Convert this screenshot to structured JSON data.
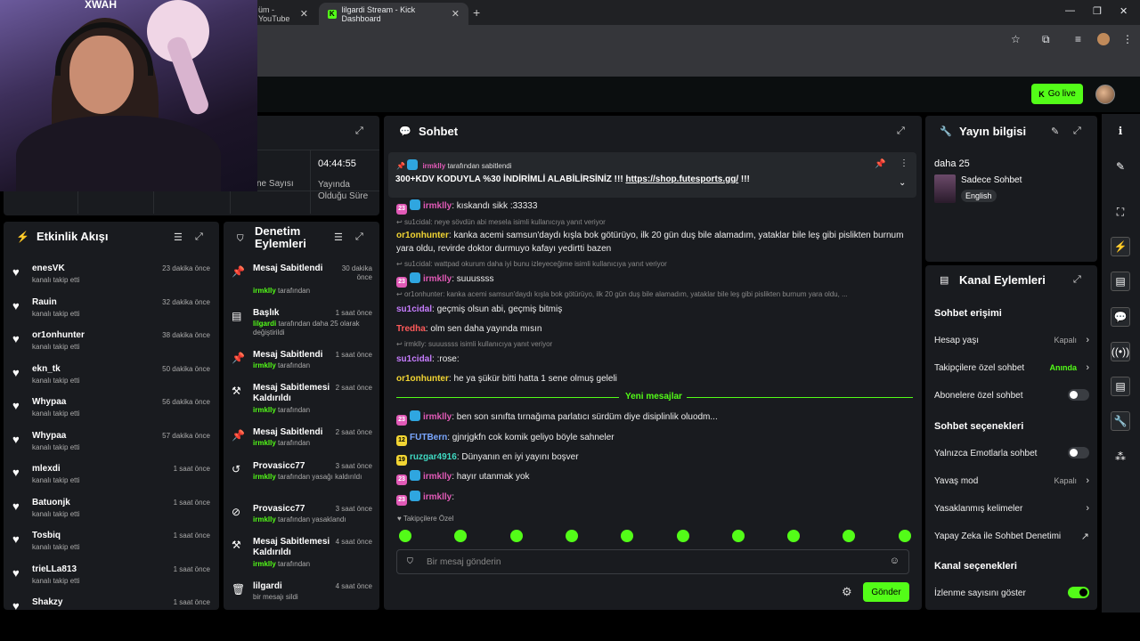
{
  "browser": {
    "tabs": [
      {
        "title": "üm - YouTube"
      },
      {
        "title": "lilgardi Stream - Kick Dashboard"
      }
    ],
    "new_tab": "+"
  },
  "topbar": {
    "go_live": "Go live"
  },
  "stats": {
    "uptime": "04:44:55",
    "uptime_label": "Yayında Olduğu Süre",
    "viewers_label": "ne Sayısı"
  },
  "activity": {
    "title": "Etkinlik Akışı",
    "items": [
      {
        "name": "enesVK",
        "action": "kanalı takip etti",
        "time": "23 dakika önce"
      },
      {
        "name": "Rauin",
        "action": "kanalı takip etti",
        "time": "32 dakika önce"
      },
      {
        "name": "or1onhunter",
        "action": "kanalı takip etti",
        "time": "38 dakika önce"
      },
      {
        "name": "ekn_tk",
        "action": "kanalı takip etti",
        "time": "50 dakika önce"
      },
      {
        "name": "Whypaa",
        "action": "kanalı takip etti",
        "time": "56 dakika önce"
      },
      {
        "name": "Whypaa",
        "action": "kanalı takip etti",
        "time": "57 dakika önce"
      },
      {
        "name": "mlexdi",
        "action": "kanalı takip etti",
        "time": "1 saat önce"
      },
      {
        "name": "Batuonjk",
        "action": "kanalı takip etti",
        "time": "1 saat önce"
      },
      {
        "name": "Tosbiq",
        "action": "kanalı takip etti",
        "time": "1 saat önce"
      },
      {
        "name": "trieLLa813",
        "action": "kanalı takip etti",
        "time": "1 saat önce"
      },
      {
        "name": "Shakzy",
        "action": "",
        "time": "1 saat önce"
      }
    ]
  },
  "moderation": {
    "title": "Denetim Eylemleri",
    "items": [
      {
        "title": "Mesaj Sabitlendi",
        "actor": "irmklly",
        "suffix": "tarafından",
        "time": "30 dakika önce",
        "icon": "pin-icon"
      },
      {
        "title": "Başlık",
        "actor": "lilgardi",
        "suffix": "tarafından daha 25 olarak değiştirildi",
        "time": "1 saat önce",
        "icon": "title-icon"
      },
      {
        "title": "Mesaj Sabitlendi",
        "actor": "irmklly",
        "suffix": "tarafından",
        "time": "1 saat önce",
        "icon": "pin-icon"
      },
      {
        "title": "Mesaj Sabitlemesi Kaldırıldı",
        "actor": "irmklly",
        "suffix": "tarafından",
        "time": "2 saat önce",
        "icon": "unpin-icon"
      },
      {
        "title": "Mesaj Sabitlendi",
        "actor": "irmklly",
        "suffix": "tarafından",
        "time": "2 saat önce",
        "icon": "pin-icon"
      },
      {
        "title": "Provasicc77",
        "actor": "irmklly",
        "suffix": "tarafından yasağı kaldırıldı",
        "time": "3 saat önce",
        "icon": "undo-icon"
      },
      {
        "title": "Provasicc77",
        "actor": "irmklly",
        "suffix": "tarafından yasaklandı",
        "time": "3 saat önce",
        "icon": "ban-icon"
      },
      {
        "title": "Mesaj Sabitlemesi Kaldırıldı",
        "actor": "irmklly",
        "suffix": "tarafından",
        "time": "4 saat önce",
        "icon": "unpin-icon"
      },
      {
        "title": "lilgardi",
        "actor": "",
        "suffix": "bir mesajı sildi",
        "time": "4 saat önce",
        "icon": "trash-icon"
      }
    ]
  },
  "chat": {
    "title": "Sohbet",
    "pinned": {
      "by_user": "irmklly",
      "by_text": "tarafından sabitlendi",
      "message": "300+KDV KODUYLA %30 İNDİRİMLİ ALABİLİRSİNİZ !!!",
      "link": "https://shop.futesports.gg/",
      "suffix": "!!!"
    },
    "messages": [
      {
        "type": "msg",
        "user": "irmklly",
        "color": "#e15ab7",
        "text": ": kıskandı sikk :33333",
        "badges": [
          "b-pink",
          "b-blue"
        ]
      },
      {
        "type": "reply",
        "text": "su1cidal: neye sövdün abi mesela isimli kullanıcıya yanıt veriyor"
      },
      {
        "type": "msg",
        "user": "or1onhunter",
        "color": "#f2d533",
        "text": ": kanka acemi samsun'daydı kışla bok götürüyo, ilk 20 gün duş bile alamadım, yataklar bile leş gibi pislikten burnum yara oldu, revirde doktor durmuyo kafayı yedirtti bazen",
        "badges": []
      },
      {
        "type": "reply",
        "text": "su1cidal: wattpad okurum daha iyi bunu izleyeceğime isimli kullanıcıya yanıt veriyor"
      },
      {
        "type": "msg",
        "user": "irmklly",
        "color": "#e15ab7",
        "text": ": suuussss",
        "badges": [
          "b-pink",
          "b-blue"
        ]
      },
      {
        "type": "reply",
        "text": "or1onhunter: kanka acemi samsun'daydı kışla bok götürüyo, ilk 20 gün duş bile alamadım, yataklar bile leş gibi pislikten burnum yara oldu, ..."
      },
      {
        "type": "msg",
        "user": "su1cidal",
        "color": "#c77dff",
        "text": ": geçmiş olsun abi, geçmiş bitmiş",
        "badges": []
      },
      {
        "type": "msg",
        "user": "Tredha",
        "color": "#ff5a5a",
        "text": ": olm sen daha yayında mısın",
        "badges": []
      },
      {
        "type": "reply",
        "text": "irmklly: suuussss isimli kullanıcıya yanıt veriyor"
      },
      {
        "type": "msg",
        "user": "su1cidal",
        "color": "#c77dff",
        "text": ": :rose:",
        "badges": []
      },
      {
        "type": "msg",
        "user": "or1onhunter",
        "color": "#f2d533",
        "text": ": he ya şükür bitti hatta 1 sene olmuş geleli",
        "badges": []
      }
    ],
    "new_messages_label": "Yeni mesajlar",
    "new_messages": [
      {
        "user": "irmklly",
        "color": "#e15ab7",
        "text": ": ben son sınıfta tırnağıma parlatıcı sürdüm diye disiplinlik oluodm...",
        "badges": [
          "b-pink",
          "b-blue"
        ],
        "badge_text": [
          "23",
          ""
        ]
      },
      {
        "user": "FUTBern",
        "color": "#7aa7ff",
        "text": ": gjnrjgkfn cok komik geliyo böyle sahneler",
        "badges": [
          "b-yellow"
        ],
        "badge_text": [
          "12"
        ]
      },
      {
        "user": "ruzgar4916",
        "color": "#3fd9c2",
        "text": ": Dünyanın en iyi yayını boşver",
        "badges": [
          "b-yellow"
        ],
        "badge_text": [
          "19"
        ]
      },
      {
        "user": "irmklly",
        "color": "#e15ab7",
        "text": ": hayır utanmak yok",
        "badges": [
          "b-pink",
          "b-blue"
        ],
        "badge_text": [
          "23",
          ""
        ]
      },
      {
        "user": "irmklly",
        "color": "#e15ab7",
        "text": ":",
        "badges": [
          "b-pink",
          "b-blue"
        ],
        "badge_text": [
          "23",
          ""
        ]
      }
    ],
    "followers_only": "Takipçilere Özel",
    "input_placeholder": "Bir mesaj gönderin",
    "send": "Gönder"
  },
  "stream_info": {
    "title": "Yayın bilgisi",
    "stream_title": "daha 25",
    "category": "Sadece Sohbet",
    "language": "English"
  },
  "channel_actions": {
    "title": "Kanal Eylemleri",
    "chat_access": "Sohbet erişimi",
    "rows_access": [
      {
        "label": "Hesap yaşı",
        "value": "Kapalı",
        "kind": "chev"
      },
      {
        "label": "Takipçilere özel sohbet",
        "value": "Anında",
        "kind": "chev",
        "green": true
      },
      {
        "label": "Abonelere özel sohbet",
        "value": "",
        "kind": "toggle",
        "on": false
      }
    ],
    "chat_options": "Sohbet seçenekleri",
    "rows_options": [
      {
        "label": "Yalnızca Emotlarla sohbet",
        "value": "",
        "kind": "toggle",
        "on": false
      },
      {
        "label": "Yavaş mod",
        "value": "Kapalı",
        "kind": "chev"
      },
      {
        "label": "Yasaklanmış kelimeler",
        "value": "",
        "kind": "chev"
      },
      {
        "label": "Yapay Zeka ile Sohbet Denetimi",
        "value": "",
        "kind": "ext"
      }
    ],
    "channel_options": "Kanal seçenekleri",
    "rows_channel": [
      {
        "label": "İzlenme sayısını göster",
        "value": "",
        "kind": "toggle",
        "on": true
      }
    ]
  },
  "colors": {
    "accent": "#53fc18",
    "panel": "#191b1f",
    "background": "#0b0e0f"
  }
}
